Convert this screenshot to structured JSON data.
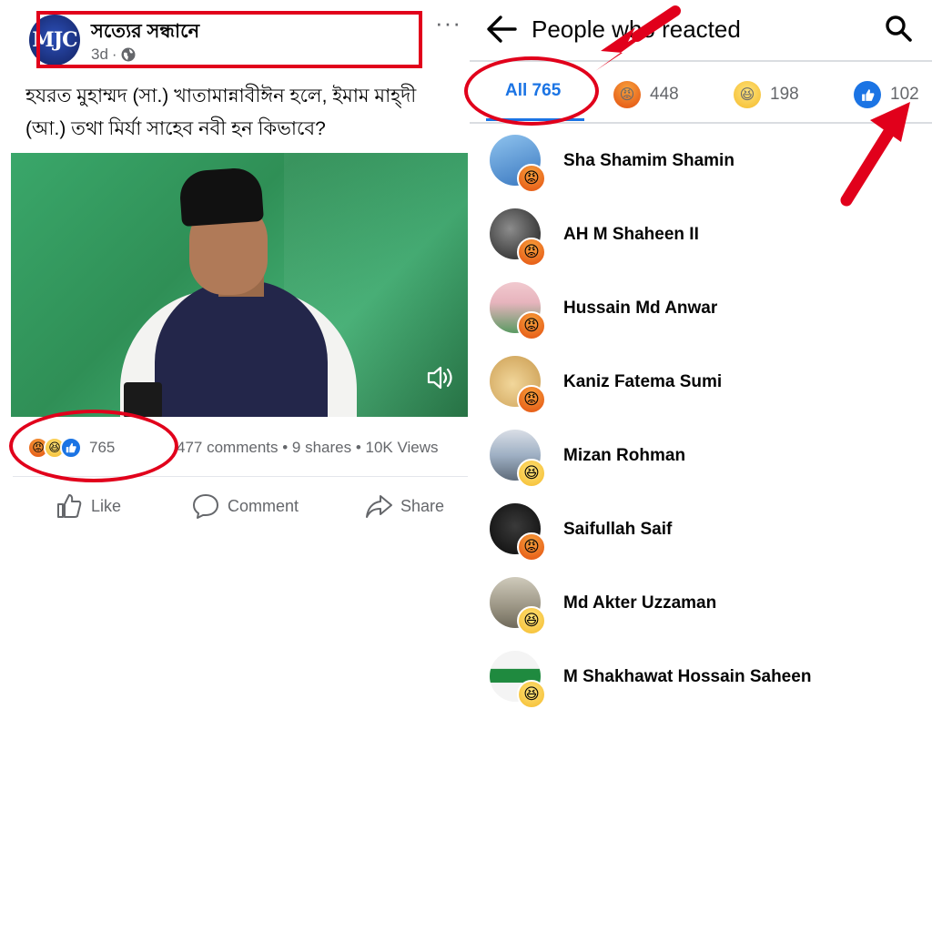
{
  "post": {
    "page_name": "সত্যের সন্ধানে",
    "logo_text": "MJC",
    "time": "3d",
    "text_line1": "হযরত মুহাম্মদ (সা.) খাতামান্নাবীঈন হলে, ইমাম মাহ্‌দী",
    "text_line2": "(আ.) তথা মির্যা সাহেব নবী হন কিভাবে?",
    "reaction_count": "765",
    "stats": "477 comments • 9 shares • 10K Views",
    "actions": {
      "like": "Like",
      "comment": "Comment",
      "share": "Share"
    },
    "more": "···"
  },
  "panel": {
    "title": "People who reacted",
    "tabs": [
      {
        "label": "All 765",
        "icon": "all"
      },
      {
        "label": "448",
        "icon": "angry-icon"
      },
      {
        "label": "198",
        "icon": "haha-icon"
      },
      {
        "label": "102",
        "icon": "like-icon"
      }
    ],
    "people": [
      {
        "name": "Sha Shamim Shamin",
        "reaction": "angry-icon"
      },
      {
        "name": "AH M Shaheen II",
        "reaction": "angry-icon"
      },
      {
        "name": "Hussain Md Anwar",
        "reaction": "angry-icon"
      },
      {
        "name": "Kaniz Fatema Sumi",
        "reaction": "angry-icon"
      },
      {
        "name": "Mizan Rohman",
        "reaction": "haha-icon"
      },
      {
        "name": "Saifullah Saif",
        "reaction": "angry-icon"
      },
      {
        "name": "Md Akter Uzzaman",
        "reaction": "haha-icon"
      },
      {
        "name": "M Shakhawat Hossain Saheen",
        "reaction": "haha-icon"
      }
    ]
  },
  "colors": {
    "accent": "#1b74e4",
    "annotation": "#e1001b",
    "muted_text": "#65676b"
  }
}
